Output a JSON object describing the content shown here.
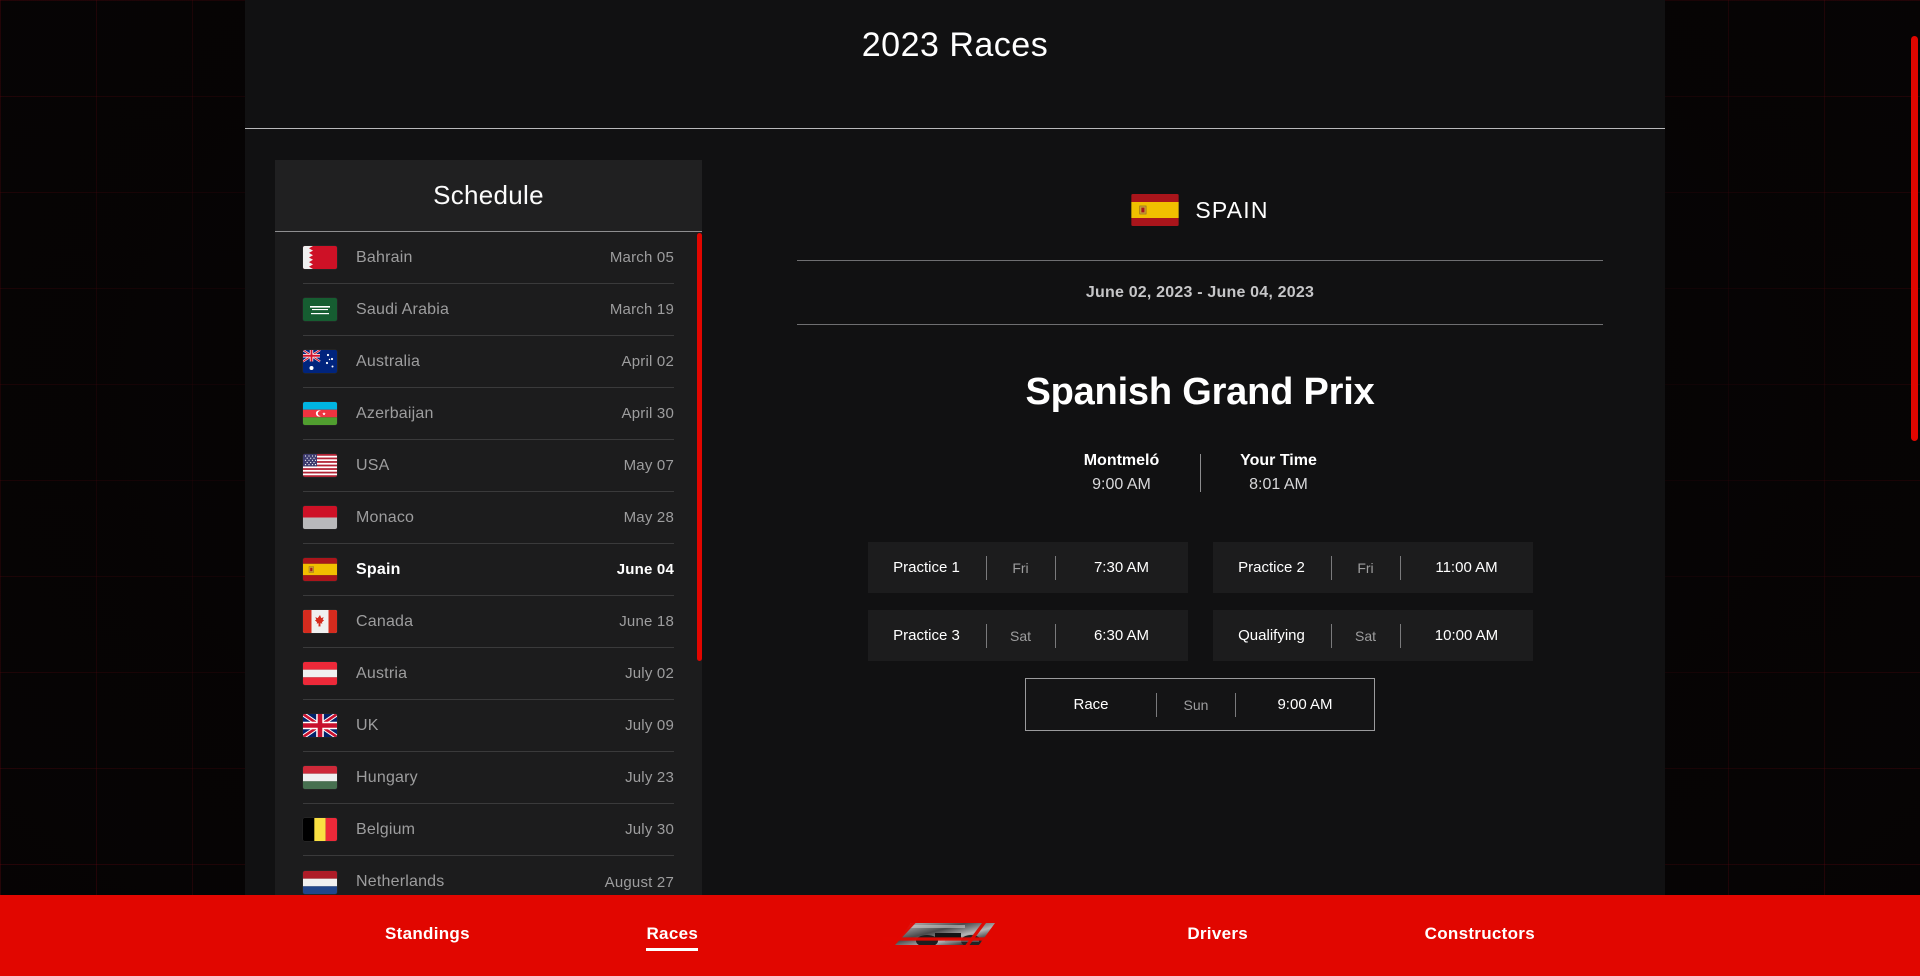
{
  "header": {
    "title": "2023 Races"
  },
  "schedule": {
    "panel_title": "Schedule",
    "races": [
      {
        "country": "Bahrain",
        "date": "March 05",
        "flag": "bahrain",
        "selected": false
      },
      {
        "country": "Saudi Arabia",
        "date": "March 19",
        "flag": "saudi",
        "selected": false
      },
      {
        "country": "Australia",
        "date": "April 02",
        "flag": "australia",
        "selected": false
      },
      {
        "country": "Azerbaijan",
        "date": "April 30",
        "flag": "azerbaijan",
        "selected": false
      },
      {
        "country": "USA",
        "date": "May 07",
        "flag": "usa",
        "selected": false
      },
      {
        "country": "Monaco",
        "date": "May 28",
        "flag": "monaco",
        "selected": false
      },
      {
        "country": "Spain",
        "date": "June 04",
        "flag": "spain",
        "selected": true
      },
      {
        "country": "Canada",
        "date": "June 18",
        "flag": "canada",
        "selected": false
      },
      {
        "country": "Austria",
        "date": "July 02",
        "flag": "austria",
        "selected": false
      },
      {
        "country": "UK",
        "date": "July 09",
        "flag": "uk",
        "selected": false
      },
      {
        "country": "Hungary",
        "date": "July 23",
        "flag": "hungary",
        "selected": false
      },
      {
        "country": "Belgium",
        "date": "July 30",
        "flag": "belgium",
        "selected": false
      },
      {
        "country": "Netherlands",
        "date": "August 27",
        "flag": "netherlands",
        "selected": false
      }
    ]
  },
  "detail": {
    "country_name": "SPAIN",
    "country_flag": "spain",
    "date_range": "June 02, 2023 - June 04, 2023",
    "grand_prix": "Spanish Grand Prix",
    "local_time": {
      "label": "Montmeló",
      "value": "9:00 AM"
    },
    "your_time": {
      "label": "Your Time",
      "value": "8:01 AM"
    },
    "sessions": [
      {
        "name": "Practice 1",
        "day": "Fri",
        "time": "7:30 AM",
        "highlight": false
      },
      {
        "name": "Practice 2",
        "day": "Fri",
        "time": "11:00 AM",
        "highlight": false
      },
      {
        "name": "Practice 3",
        "day": "Sat",
        "time": "6:30 AM",
        "highlight": false
      },
      {
        "name": "Qualifying",
        "day": "Sat",
        "time": "10:00 AM",
        "highlight": false
      },
      {
        "name": "Race",
        "day": "Sun",
        "time": "9:00 AM",
        "highlight": true
      }
    ]
  },
  "nav": {
    "items": [
      {
        "label": "Standings",
        "active": false
      },
      {
        "label": "Races",
        "active": true
      },
      {
        "label": "Drivers",
        "active": false
      },
      {
        "label": "Constructors",
        "active": false
      }
    ],
    "logo": "f1-logo"
  },
  "colors": {
    "brand_red": "#e10600",
    "surface": "#111112",
    "card": "#1c1c1d",
    "muted_text": "#9d9d9e"
  }
}
